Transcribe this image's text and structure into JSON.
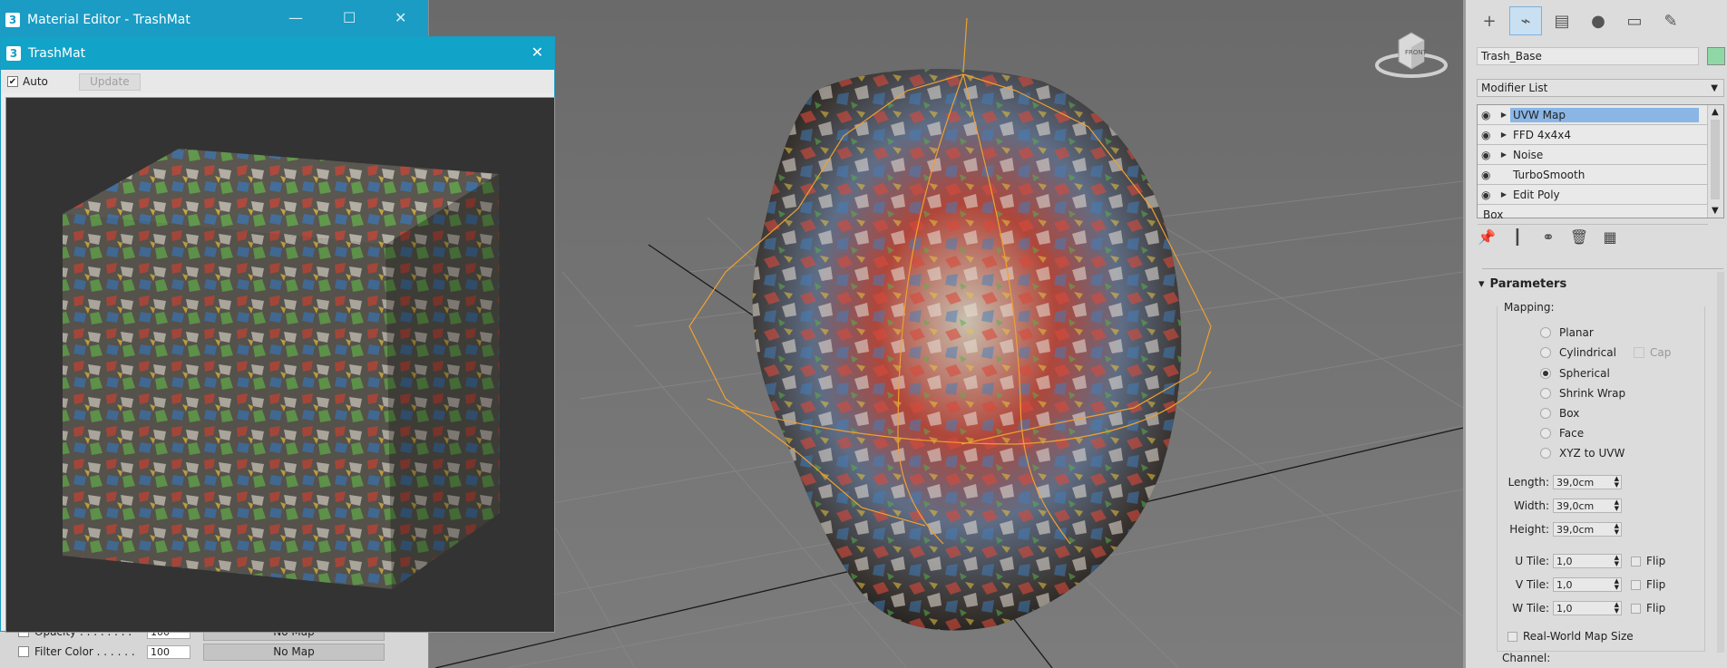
{
  "material_editor_back": {
    "title": "Material Editor - TrashMat",
    "rows": [
      {
        "label": "Opacity . . . . . . . .",
        "value": "100",
        "map": "No Map"
      },
      {
        "label": "Filter Color . . . . . .",
        "value": "100",
        "map": "No Map"
      }
    ]
  },
  "material_editor_front": {
    "title": "TrashMat",
    "auto_label": "Auto",
    "update_label": "Update"
  },
  "viewcube": {
    "label": "FRONT"
  },
  "command_panel": {
    "object_name": "Trash_Base",
    "object_color": "#8fd8a6",
    "modifier_list_label": "Modifier List",
    "stack": [
      {
        "name": "UVW Map",
        "selected": true
      },
      {
        "name": "FFD 4x4x4"
      },
      {
        "name": "Noise"
      },
      {
        "name": "TurboSmooth"
      },
      {
        "name": "Edit Poly"
      },
      {
        "name": "Box"
      }
    ],
    "parameters": {
      "title": "Parameters",
      "mapping_label": "Mapping:",
      "mapping_options": [
        "Planar",
        "Cylindrical",
        "Spherical",
        "Shrink Wrap",
        "Box",
        "Face",
        "XYZ to UVW"
      ],
      "selected_mapping": "Spherical",
      "cap_label": "Cap",
      "length_label": "Length:",
      "length": "39,0cm",
      "width_label": "Width:",
      "width": "39,0cm",
      "height_label": "Height:",
      "height": "39,0cm",
      "utile_label": "U Tile:",
      "utile": "1,0",
      "vtile_label": "V Tile:",
      "vtile": "1,0",
      "wtile_label": "W Tile:",
      "wtile": "1,0",
      "flip_label": "Flip",
      "realworld_label": "Real-World Map Size",
      "channel_label": "Channel:"
    }
  }
}
